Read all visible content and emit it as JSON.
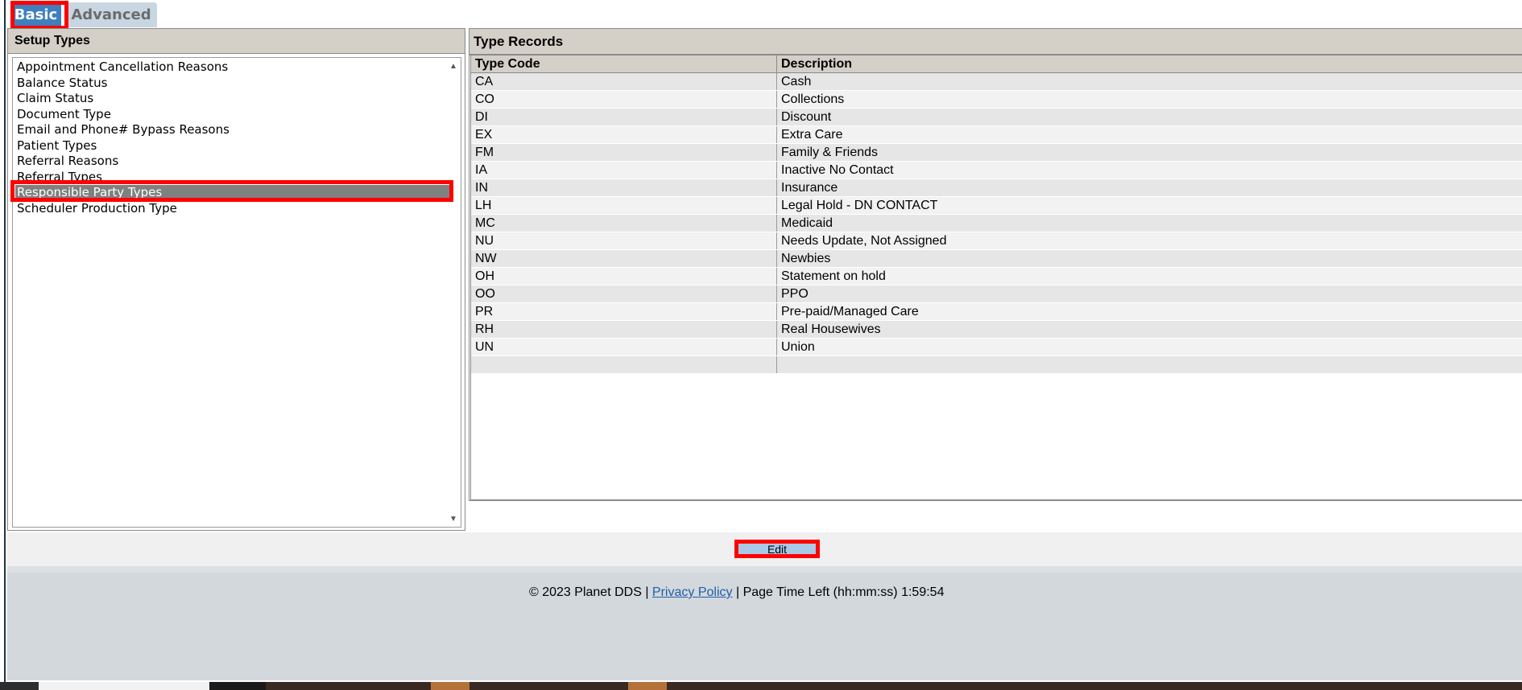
{
  "tabs": {
    "basic": "Basic",
    "advanced": "Advanced"
  },
  "setup": {
    "header": "Setup Types",
    "items": [
      "Appointment Cancellation Reasons",
      "Balance Status",
      "Claim Status",
      "Document Type",
      "Email and Phone# Bypass Reasons",
      "Patient Types",
      "Referral Reasons",
      "Referral Types",
      "Responsible Party Types",
      "Scheduler Production Type"
    ],
    "selected": "Responsible Party Types"
  },
  "records": {
    "header": "Type Records",
    "columns": {
      "code": "Type Code",
      "description": "Description"
    },
    "rows": [
      {
        "code": "CA",
        "description": "Cash"
      },
      {
        "code": "CO",
        "description": "Collections"
      },
      {
        "code": "DI",
        "description": "Discount"
      },
      {
        "code": "EX",
        "description": "Extra Care"
      },
      {
        "code": "FM",
        "description": "Family & Friends"
      },
      {
        "code": "IA",
        "description": "Inactive No Contact"
      },
      {
        "code": "IN",
        "description": "Insurance"
      },
      {
        "code": "LH",
        "description": "Legal Hold - DN CONTACT"
      },
      {
        "code": "MC",
        "description": "Medicaid"
      },
      {
        "code": "NU",
        "description": "Needs Update, Not Assigned"
      },
      {
        "code": "NW",
        "description": "Newbies"
      },
      {
        "code": "OH",
        "description": "Statement on hold"
      },
      {
        "code": "OO",
        "description": "PPO"
      },
      {
        "code": "PR",
        "description": "Pre-paid/Managed Care"
      },
      {
        "code": "RH",
        "description": "Real Housewives"
      },
      {
        "code": "UN",
        "description": "Union"
      }
    ]
  },
  "buttons": {
    "edit": "Edit"
  },
  "footer": {
    "copyright": "© 2023 Planet DDS |",
    "privacy": "Privacy Policy",
    "separator": "|",
    "time_label": "Page Time Left (hh:mm:ss)",
    "time_value": "1:59:54"
  },
  "icons": {
    "scroll_up": "scroll-up-arrow-icon",
    "scroll_down": "scroll-down-arrow-icon"
  }
}
